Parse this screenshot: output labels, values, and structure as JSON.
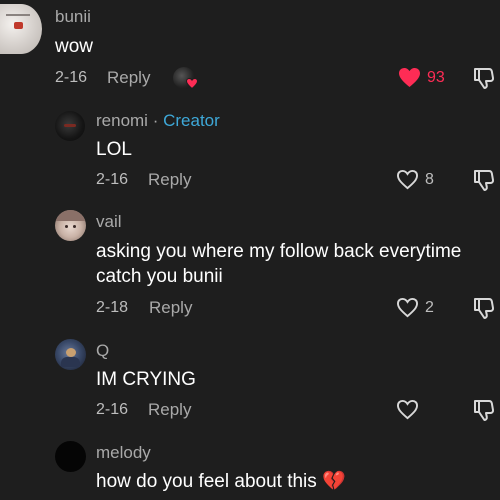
{
  "comments": [
    {
      "username": "bunii",
      "text": "wow",
      "date": "2-16",
      "reply_label": "Reply",
      "likes": "93",
      "liked": true
    },
    {
      "username": "renomi",
      "creator_separator": "·",
      "creator_label": "Creator",
      "text": "LOL",
      "date": "2-16",
      "reply_label": "Reply",
      "likes": "8"
    },
    {
      "username": "vail",
      "text_line1": "asking you where my follow back everytime",
      "text_line2": "catch you bunii",
      "date": "2-18",
      "reply_label": "Reply",
      "likes": "2"
    },
    {
      "username": "Q",
      "text": "IM CRYING",
      "date": "2-16",
      "reply_label": "Reply",
      "likes": ""
    },
    {
      "username": "melody",
      "text": "how do you feel about this 💔"
    }
  ],
  "colors": {
    "background": "#1e1e1e",
    "liked_heart": "#fe2c55",
    "creator": "#3ea8d8"
  },
  "icons": [
    "heart-icon",
    "heart-filled-icon",
    "dislike-icon",
    "broken-heart-emoji"
  ]
}
